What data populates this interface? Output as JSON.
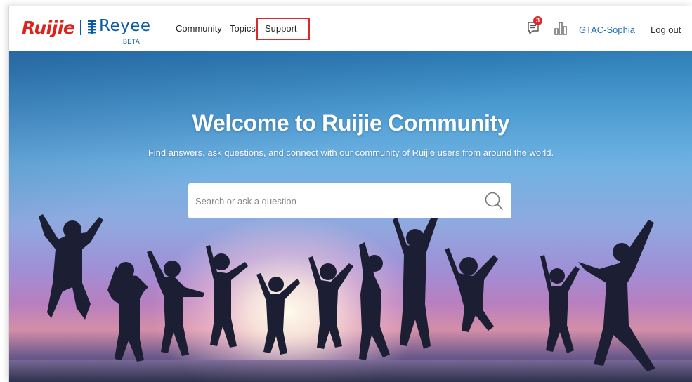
{
  "header": {
    "logo_ruijie": "Ruijie",
    "logo_reyee": "Reyee",
    "logo_beta": "BETA",
    "nav": {
      "community": "Community",
      "topics": "Topics",
      "support": "Support"
    },
    "notification_count": "3",
    "user_name": "GTAC-Sophia",
    "logout": "Log out"
  },
  "hero": {
    "title": "Welcome to Ruijie Community",
    "subtitle": "Find answers, ask questions, and connect with our community of Ruijie users from around the world.",
    "search_placeholder": "Search or ask a question"
  },
  "colors": {
    "brand_red": "#d9251d",
    "brand_blue": "#0b5aa8",
    "link_blue": "#1f6fb8",
    "highlight_border": "#e0282a"
  },
  "icons": {
    "notification": "chat-bubble-icon",
    "stats": "bar-chart-icon",
    "search": "search-icon"
  }
}
